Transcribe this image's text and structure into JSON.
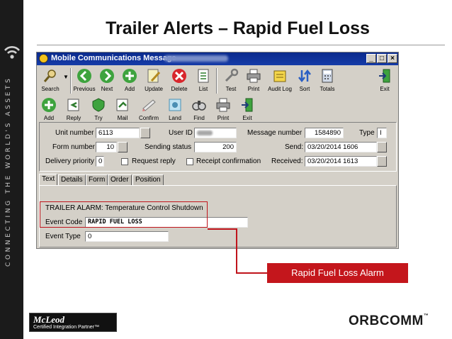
{
  "slide": {
    "title": "Trailer Alerts – Rapid Fuel Loss",
    "tagline": "CONNECTING THE WORLD'S ASSETS",
    "callout": "Rapid Fuel Loss Alarm",
    "logo_left_main": "McLeod",
    "logo_left_sub": "Certified Integration Partner™",
    "logo_right": "ORBCOMM",
    "logo_right_tm": "™"
  },
  "window": {
    "title": "Mobile Communications Message -",
    "title_suffix": "ABC Trucking, CO",
    "min_glyph": "_",
    "max_glyph": "□",
    "close_glyph": "×"
  },
  "toolbar1": [
    {
      "label": "Search",
      "icon": "search-icon"
    },
    {
      "label": "Previous",
      "icon": "previous-icon"
    },
    {
      "label": "Next",
      "icon": "next-icon"
    },
    {
      "label": "Add",
      "icon": "add-icon"
    },
    {
      "label": "Update",
      "icon": "update-icon"
    },
    {
      "label": "Delete",
      "icon": "delete-icon"
    },
    {
      "label": "List",
      "icon": "list-icon"
    },
    {
      "label": "Test",
      "icon": "test-icon"
    },
    {
      "label": "Print",
      "icon": "print-icon"
    },
    {
      "label": "Audit Log",
      "icon": "audit-log-icon"
    },
    {
      "label": "Sort",
      "icon": "sort-icon"
    },
    {
      "label": "Totals",
      "icon": "totals-icon"
    },
    {
      "label": "Exit",
      "icon": "exit-icon"
    }
  ],
  "toolbar2": [
    {
      "label": "Add",
      "icon": "add-icon"
    },
    {
      "label": "Reply",
      "icon": "reply-icon"
    },
    {
      "label": "Try",
      "icon": "try-icon"
    },
    {
      "label": "Mail",
      "icon": "mail-icon"
    },
    {
      "label": "Confirm",
      "icon": "confirm-icon"
    },
    {
      "label": "Land",
      "icon": "land-icon"
    },
    {
      "label": "Find",
      "icon": "find-icon"
    },
    {
      "label": "Print",
      "icon": "print-icon"
    },
    {
      "label": "Exit",
      "icon": "exit-icon"
    }
  ],
  "form": {
    "unit_number_label": "Unit number",
    "unit_number": "6113",
    "user_id_label": "User ID",
    "message_number_label": "Message number",
    "message_number": "1584890",
    "type_label": "Type",
    "type": "I",
    "form_number_label": "Form number",
    "form_number": "10",
    "sending_status_label": "Sending status",
    "sending_status": "200",
    "send_label": "Send:",
    "send": "03/20/2014 1606",
    "delivery_priority_label": "Delivery priority",
    "delivery_priority": "0",
    "request_reply_label": "Request reply",
    "receipt_confirmation_label": "Receipt confirmation",
    "received_label": "Received:",
    "received": "03/20/2014 1613"
  },
  "tabs": [
    "Text",
    "Details",
    "Form",
    "Order",
    "Position"
  ],
  "text_tab": {
    "alarm_text": "TRAILER ALARM: Temperature Control Shutdown",
    "event_code_label": "Event Code",
    "event_code": "RAPID FUEL LOSS",
    "event_type_label": "Event Type",
    "event_type": "0"
  },
  "colors": {
    "accent_red": "#c4161c",
    "titlebar_blue": "#0a2a8c",
    "window_grey": "#d4d0c8"
  }
}
